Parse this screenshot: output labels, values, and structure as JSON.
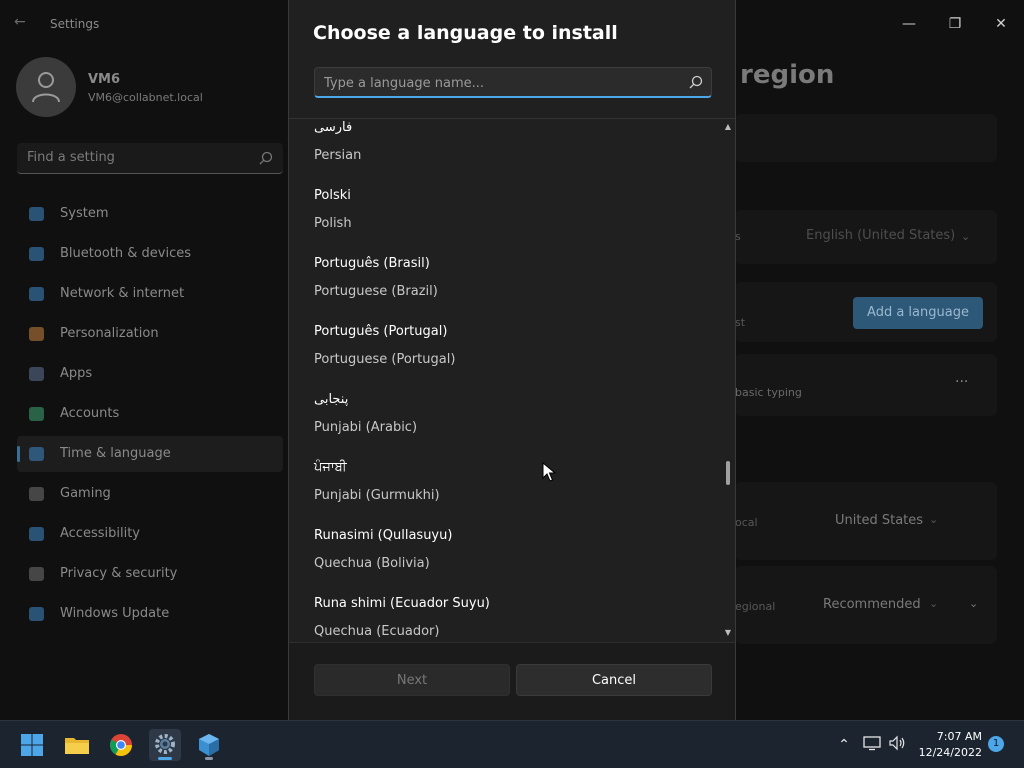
{
  "settings": {
    "app_title": "Settings",
    "user": {
      "name": "VM6",
      "email": "VM6@collabnet.local"
    },
    "search_placeholder": "Find a setting",
    "nav": [
      {
        "label": "System",
        "color": "#3a7fb8"
      },
      {
        "label": "Bluetooth & devices",
        "color": "#3a7fb8"
      },
      {
        "label": "Network & internet",
        "color": "#3a7fb8"
      },
      {
        "label": "Personalization",
        "color": "#b87a3a"
      },
      {
        "label": "Apps",
        "color": "#5a6a8a"
      },
      {
        "label": "Accounts",
        "color": "#3a9a6a"
      },
      {
        "label": "Time & language",
        "color": "#3a7fb8"
      },
      {
        "label": "Gaming",
        "color": "#6a6a6a"
      },
      {
        "label": "Accessibility",
        "color": "#3a7fb8"
      },
      {
        "label": "Privacy & security",
        "color": "#6a6a6a"
      },
      {
        "label": "Windows Update",
        "color": "#3a7fb8"
      }
    ],
    "selected_nav": "Time & language",
    "page_heading": "region",
    "windows_display_language": "English (United States)",
    "add_language_label": "Add a language",
    "preferred_suffix": "st",
    "basic_typing": "basic typing",
    "more_label": "···",
    "region_label": "ocal",
    "region_value": "United States",
    "format_label": "egional",
    "format_value": "Recommended",
    "display_suffix": "s"
  },
  "dialog": {
    "title": "Choose a language to install",
    "search_placeholder": "Type a language name...",
    "languages": [
      {
        "native": "فارسی",
        "english": "Persian"
      },
      {
        "native": "Polski",
        "english": "Polish"
      },
      {
        "native": "Português (Brasil)",
        "english": "Portuguese (Brazil)"
      },
      {
        "native": "Português (Portugal)",
        "english": "Portuguese (Portugal)"
      },
      {
        "native": "پنجابی",
        "english": "Punjabi (Arabic)"
      },
      {
        "native": "ਪੰਜਾਬੀ",
        "english": "Punjabi (Gurmukhi)"
      },
      {
        "native": "Runasimi (Qullasuyu)",
        "english": "Quechua (Bolivia)"
      },
      {
        "native": "Runa shimi (Ecuador Suyu)",
        "english": "Quechua (Ecuador)"
      }
    ],
    "next_label": "Next",
    "cancel_label": "Cancel"
  },
  "taskbar": {
    "time": "7:07 AM",
    "date": "12/24/2022",
    "notification_count": "1",
    "accent": "#4ca6e8"
  }
}
